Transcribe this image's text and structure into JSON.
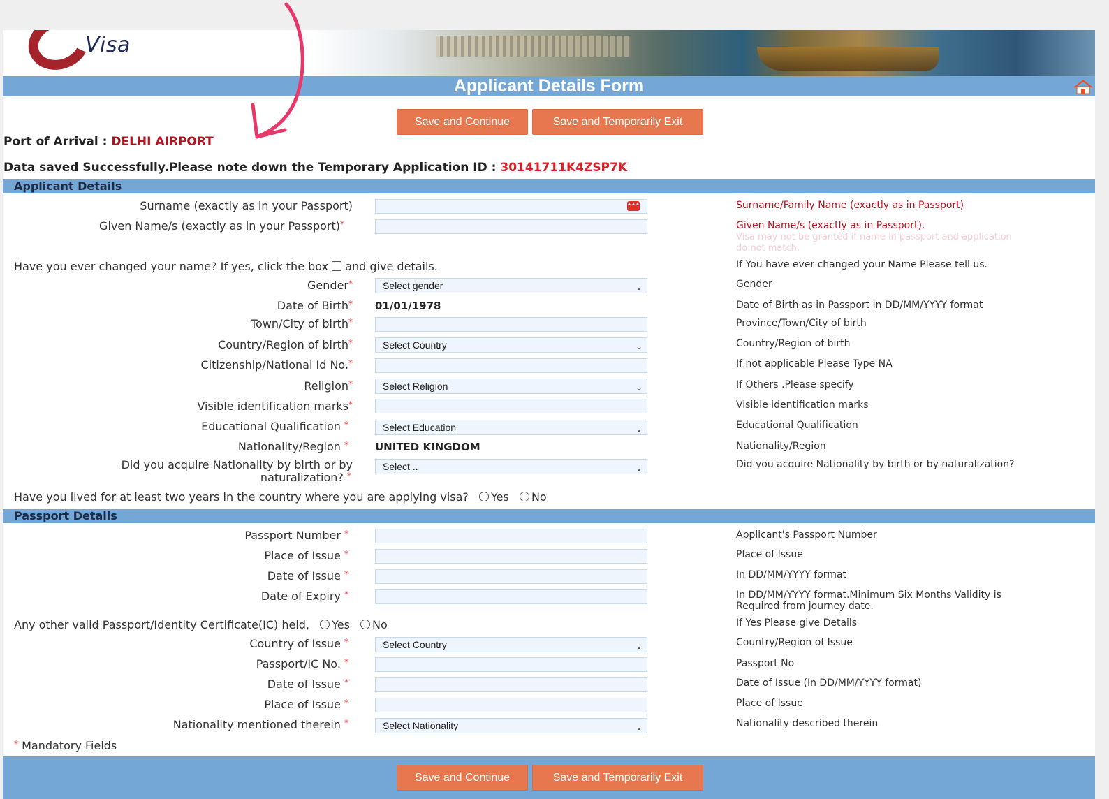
{
  "brand": {
    "logo_text": "Visa"
  },
  "title": "Applicant Details Form",
  "buttons": {
    "save_continue": "Save and Continue",
    "save_exit": "Save and Temporarily Exit"
  },
  "arrival": {
    "label": "Port of Arrival :",
    "value": "DELHI AIRPORT"
  },
  "saved": {
    "message": "Data saved Successfully.Please note down the Temporary Application ID :",
    "id": "30141711K4ZSP7K"
  },
  "sections": {
    "applicant": "Applicant Details",
    "passport": "Passport Details"
  },
  "applicant": {
    "surname_label": "Surname (exactly as in your Passport)",
    "given_label": "Given Name/s (exactly as in your Passport)",
    "changed_name_label": "Have you ever changed your name? If yes, click the box",
    "changed_name_suffix": "and give details.",
    "gender_label": "Gender",
    "gender_value": "Select gender",
    "dob_label": "Date of Birth",
    "dob_value": "01/01/1978",
    "town_label": "Town/City of birth",
    "country_birth_label": "Country/Region of birth",
    "country_birth_value": "Select Country",
    "citizenship_label": "Citizenship/National Id No.",
    "religion_label": "Religion",
    "religion_value": "Select Religion",
    "marks_label": "Visible identification marks",
    "education_label": "Educational Qualification",
    "education_value": "Select Education",
    "nationality_label": "Nationality/Region",
    "nationality_value": "UNITED KINGDOM",
    "acquire_label_1": "Did you acquire Nationality by birth or by",
    "acquire_label_2": "naturalization?",
    "acquire_value": "Select ..",
    "lived_label": "Have you lived for at least two years in the country where you are applying visa?",
    "yes": "Yes",
    "no": "No"
  },
  "hints": {
    "surname": "Surname/Family Name (exactly as in Passport)",
    "given": "Given Name/s (exactly as in Passport).",
    "given_warning_1": "Visa may not be granted if name in passport and application",
    "given_warning_2": "do not match.",
    "changed": "If You have ever changed your Name Please tell us.",
    "gender": "Gender",
    "dob": "Date of Birth as in Passport in DD/MM/YYYY format",
    "town": "Province/Town/City of birth",
    "country_birth": "Country/Region of birth",
    "citizenship": "If not applicable Please Type NA",
    "religion": "If Others .Please specify",
    "marks": "Visible identification marks",
    "education": "Educational Qualification",
    "nationality": "Nationality/Region",
    "acquire": "Did you acquire Nationality by birth or by naturalization?",
    "passport_no": "Applicant's Passport Number",
    "place_issue": "Place of Issue",
    "date_issue": "In DD/MM/YYYY format",
    "expiry_1": "In DD/MM/YYYY format.Minimum Six Months Validity is",
    "expiry_2": "Required from journey date.",
    "other_passport": "If Yes Please give Details",
    "country_issue": "Country/Region of Issue",
    "ic_no": "Passport No",
    "ic_date": "Date of Issue (In DD/MM/YYYY format)",
    "ic_place": "Place of Issue",
    "ic_nationality": "Nationality described therein"
  },
  "passport": {
    "number_label": "Passport Number",
    "place_label": "Place of Issue",
    "date_issue_label": "Date of Issue",
    "expiry_label": "Date of Expiry",
    "other_label": "Any other valid Passport/Identity Certificate(IC) held,",
    "yes": "Yes",
    "no": "No",
    "country_issue_label": "Country of Issue",
    "country_issue_value": "Select Country",
    "ic_no_label": "Passport/IC No.",
    "ic_date_label": "Date of Issue",
    "ic_place_label": "Place of Issue",
    "ic_nationality_label": "Nationality mentioned therein",
    "ic_nationality_value": "Select Nationality"
  },
  "mandatory": "Mandatory Fields",
  "icons": {
    "home": "home-icon",
    "calendar": "calendar-icon",
    "chevron": "chevron-down-icon",
    "arrow": "annotation-arrow"
  },
  "colors": {
    "accent_bar": "#74a7d5",
    "button": "#e7774e",
    "highlight_red": "#b3121f",
    "annotation_pink": "#e8386a"
  }
}
